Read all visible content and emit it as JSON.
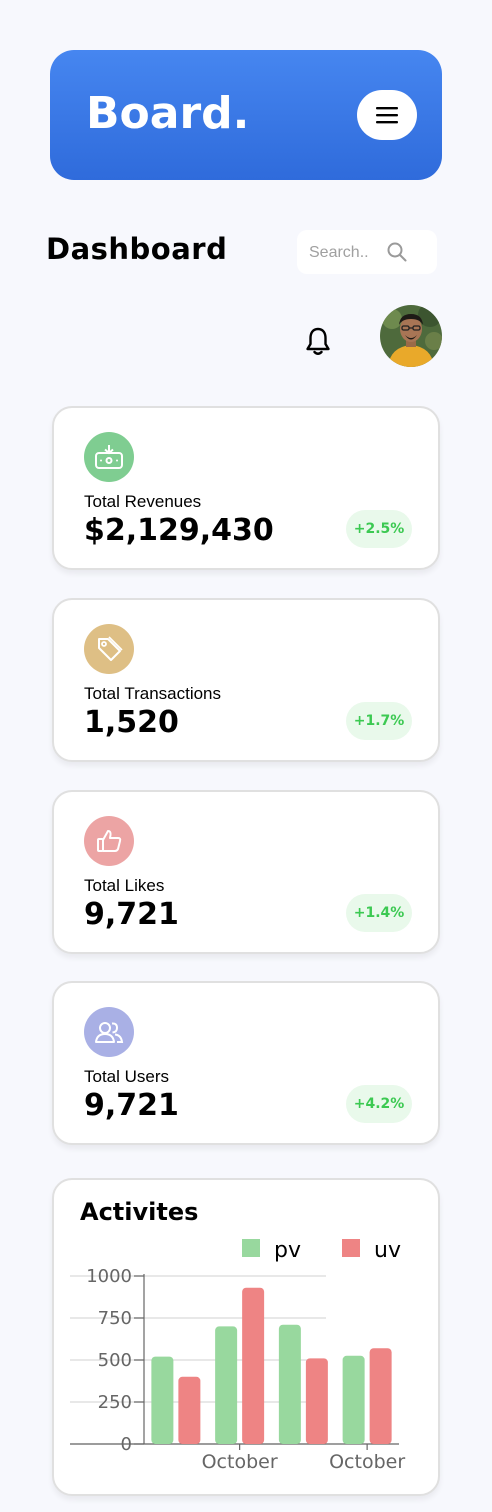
{
  "header": {
    "brand": "Board.",
    "menu_icon": "hamburger-icon"
  },
  "page_title": "Dashboard",
  "search": {
    "placeholder": "Search..",
    "icon": "search-icon"
  },
  "topbar": {
    "notification_icon": "bell-icon",
    "avatar": "user-avatar"
  },
  "stats": [
    {
      "label": "Total Revenues",
      "value": "$2,129,430",
      "change": "+2.5%",
      "icon": "money-icon",
      "icon_color": "#7FCD91"
    },
    {
      "label": "Total Transactions",
      "value": "1,520",
      "change": "+1.7%",
      "icon": "tag-icon",
      "icon_color": "#DEBF85"
    },
    {
      "label": "Total Likes",
      "value": "9,721",
      "change": "+1.4%",
      "icon": "thumbs-up-icon",
      "icon_color": "#ECA4A4"
    },
    {
      "label": "Total Users",
      "value": "9,721",
      "change": "+4.2%",
      "icon": "users-icon",
      "icon_color": "#A9B0E5"
    }
  ],
  "activities": {
    "title": "Activites",
    "chart_data": {
      "type": "bar",
      "categories": [
        "",
        "October",
        "",
        "October"
      ],
      "series": [
        {
          "name": "pv",
          "color": "#98D89E",
          "values": [
            520,
            700,
            710,
            525
          ]
        },
        {
          "name": "uv",
          "color": "#EE8484",
          "values": [
            400,
            930,
            510,
            570
          ]
        }
      ],
      "ylim": [
        0,
        1000
      ],
      "yticks": [
        "0",
        "250",
        "500",
        "750",
        "1000"
      ],
      "grid": true,
      "legend": "top-right"
    }
  }
}
